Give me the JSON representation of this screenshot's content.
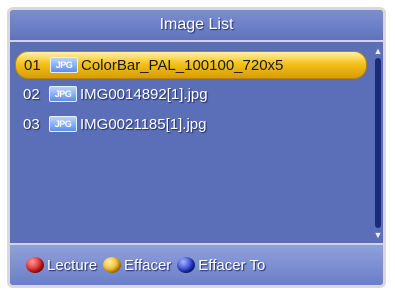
{
  "window": {
    "title": "Image List"
  },
  "list": {
    "items": [
      {
        "number": "01",
        "type_badge": "JPG",
        "name": "ColorBar_PAL_100100_720x5",
        "selected": true
      },
      {
        "number": "02",
        "type_badge": "JPG",
        "name": "IMG0014892[1].jpg",
        "selected": false
      },
      {
        "number": "03",
        "type_badge": "JPG",
        "name": "IMG0021185[1].jpg",
        "selected": false
      }
    ]
  },
  "footer": {
    "buttons": [
      {
        "color_name": "red",
        "color": "#d81818",
        "label": "Lecture"
      },
      {
        "color_name": "yellow",
        "color": "#f0b014",
        "label": "Effacer"
      },
      {
        "color_name": "blue",
        "color": "#2233c8",
        "label": "Effacer To"
      }
    ]
  },
  "icons": {
    "file_type": "jpg-file-icon",
    "scroll_up": "arrow-up-icon",
    "scroll_down": "arrow-down-icon"
  },
  "colors": {
    "panel_background": "#5a6fb8",
    "selection_highlight": "#f4c21c",
    "scroll_track": "#1b2a7a"
  }
}
